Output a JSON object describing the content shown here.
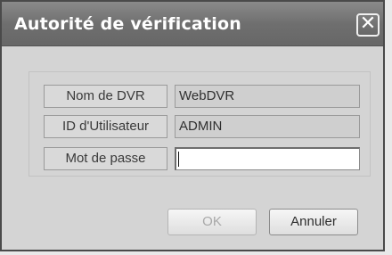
{
  "window": {
    "title": "Autorité de vérification",
    "close_glyph": "✕"
  },
  "form": {
    "dvr_name_label": "Nom de DVR",
    "dvr_name_value": "WebDVR",
    "user_id_label": "ID d'Utilisateur",
    "user_id_value": "ADMIN",
    "password_label": "Mot de passe",
    "password_value": ""
  },
  "buttons": {
    "ok_label": "OK",
    "ok_enabled": false,
    "cancel_label": "Annuler"
  }
}
